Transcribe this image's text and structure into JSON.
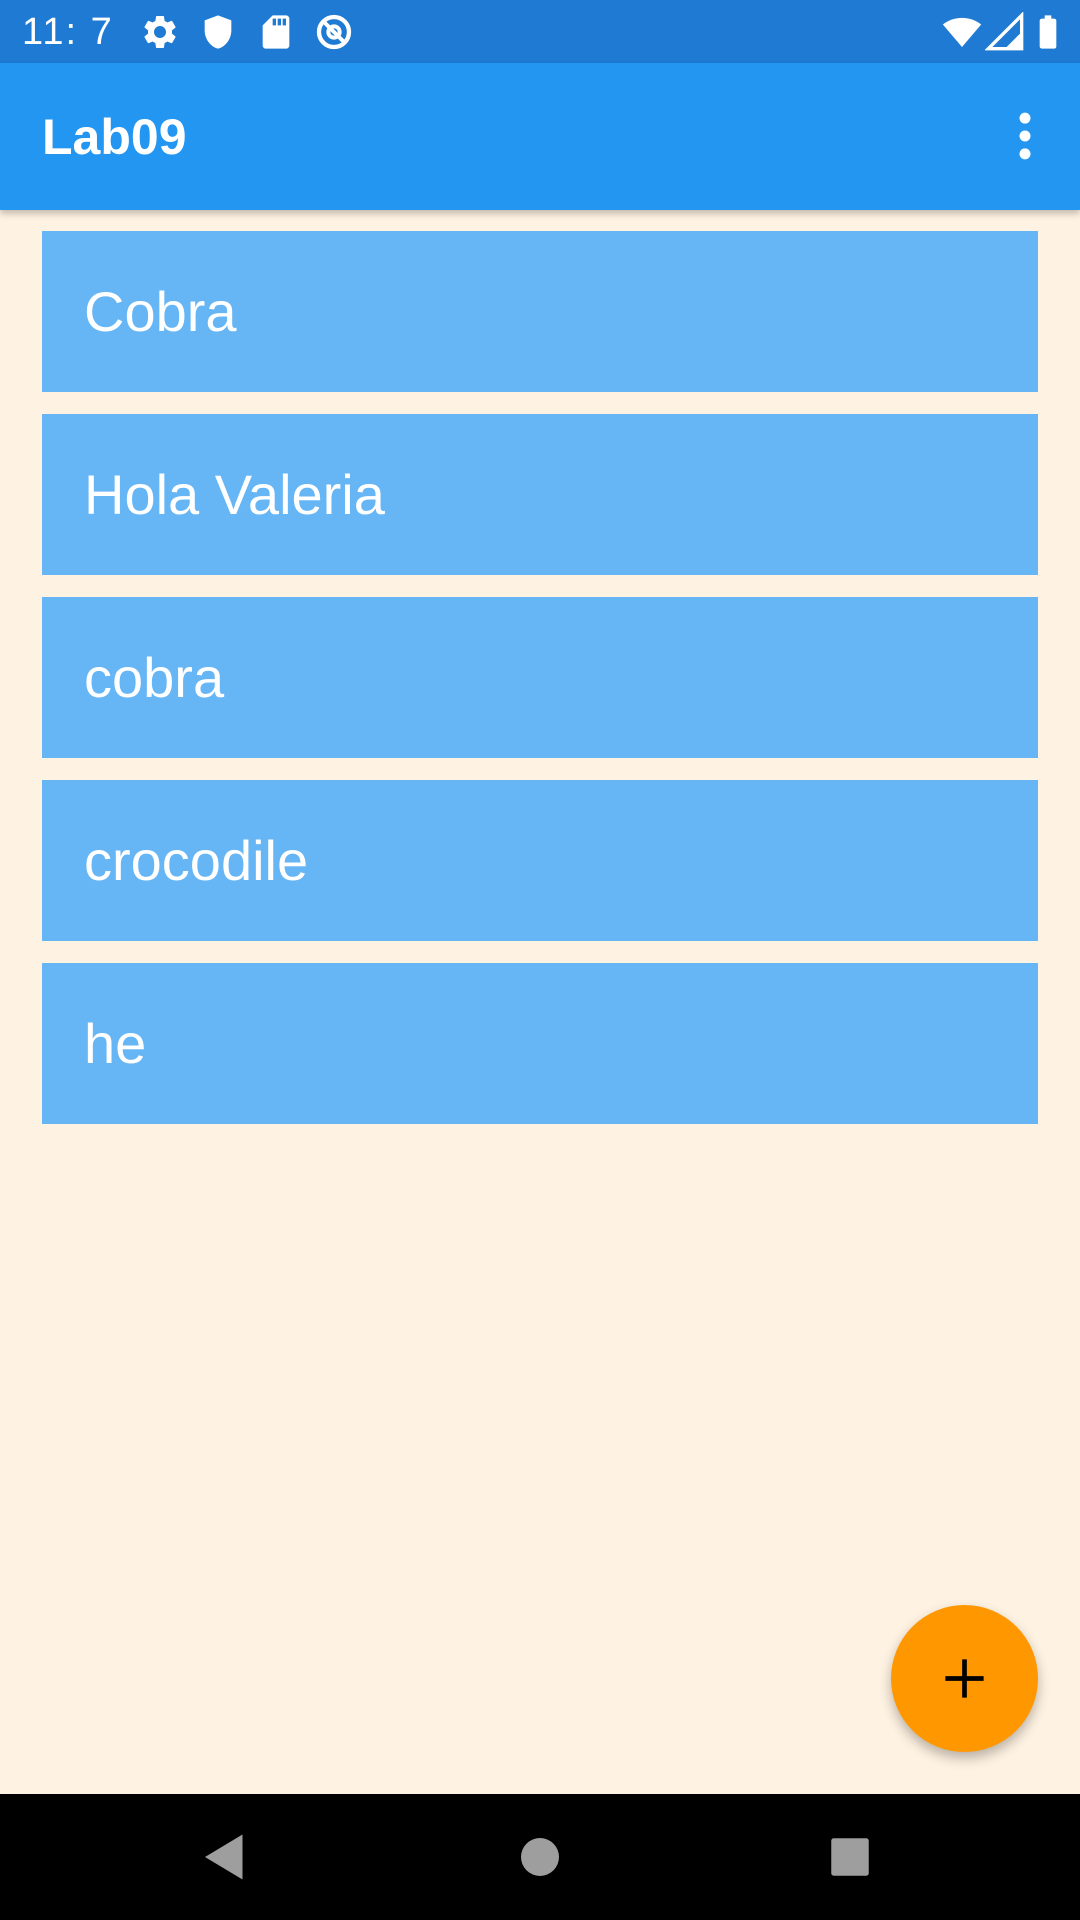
{
  "status_bar": {
    "time": "11:  7",
    "icons": [
      "settings-icon",
      "shield-icon",
      "sd-card-icon",
      "at-sign-icon",
      "wifi-icon",
      "signal-icon",
      "battery-icon"
    ]
  },
  "app_bar": {
    "title": "Lab09",
    "menu_icon": "more-vert-icon"
  },
  "list": {
    "items": [
      {
        "label": "Cobra"
      },
      {
        "label": "Hola Valeria"
      },
      {
        "label": "cobra"
      },
      {
        "label": "crocodile"
      },
      {
        "label": "he"
      }
    ]
  },
  "fab": {
    "icon": "plus-icon"
  },
  "nav_bar": {
    "icons": [
      "back-icon",
      "home-icon",
      "recents-icon"
    ]
  },
  "colors": {
    "status_bar": "#1E7AD2",
    "app_bar": "#2396F2",
    "background": "#FEF2E2",
    "list_item": "#66B5F5",
    "fab": "#FF9800",
    "nav_bar": "#000000"
  }
}
